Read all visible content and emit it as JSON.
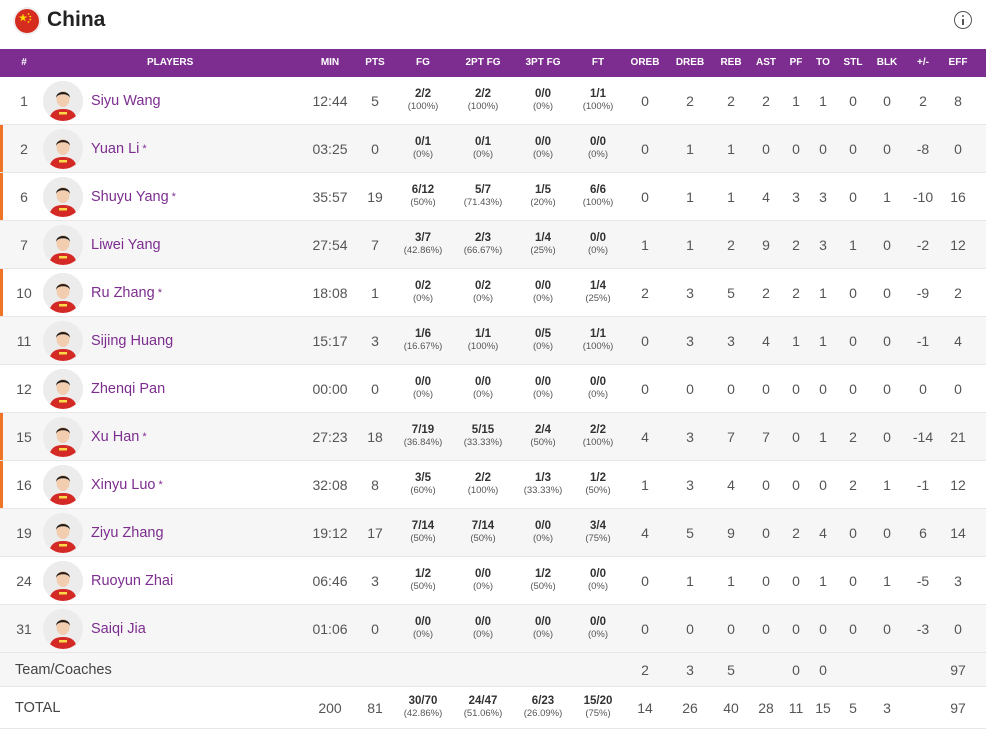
{
  "team": {
    "name": "China",
    "flag_icon": "china-flag-icon",
    "info_icon": "info-icon"
  },
  "colors": {
    "header_bg": "#7d2d8f",
    "player_name": "#7d2d8f",
    "starter_marker": "#f07426"
  },
  "columns": [
    "#",
    "PLAYERS",
    "MIN",
    "PTS",
    "FG",
    "2PT FG",
    "3PT FG",
    "FT",
    "OREB",
    "DREB",
    "REB",
    "AST",
    "PF",
    "TO",
    "STL",
    "BLK",
    "+/-",
    "EFF"
  ],
  "players": [
    {
      "num": "1",
      "name": "Siyu Wang",
      "starter": "",
      "min": "12:44",
      "pts": "5",
      "fg": "2/2",
      "fg_pct": "(100%)",
      "fg2": "2/2",
      "fg2_pct": "(100%)",
      "fg3": "0/0",
      "fg3_pct": "(0%)",
      "ft": "1/1",
      "ft_pct": "(100%)",
      "oreb": "0",
      "dreb": "2",
      "reb": "2",
      "ast": "2",
      "pf": "1",
      "to": "1",
      "stl": "0",
      "blk": "0",
      "pm": "2",
      "eff": "8"
    },
    {
      "num": "2",
      "name": "Yuan Li",
      "starter": "*",
      "min": "03:25",
      "pts": "0",
      "fg": "0/1",
      "fg_pct": "(0%)",
      "fg2": "0/1",
      "fg2_pct": "(0%)",
      "fg3": "0/0",
      "fg3_pct": "(0%)",
      "ft": "0/0",
      "ft_pct": "(0%)",
      "oreb": "0",
      "dreb": "1",
      "reb": "1",
      "ast": "0",
      "pf": "0",
      "to": "0",
      "stl": "0",
      "blk": "0",
      "pm": "-8",
      "eff": "0"
    },
    {
      "num": "6",
      "name": "Shuyu Yang",
      "starter": "*",
      "min": "35:57",
      "pts": "19",
      "fg": "6/12",
      "fg_pct": "(50%)",
      "fg2": "5/7",
      "fg2_pct": "(71.43%)",
      "fg3": "1/5",
      "fg3_pct": "(20%)",
      "ft": "6/6",
      "ft_pct": "(100%)",
      "oreb": "0",
      "dreb": "1",
      "reb": "1",
      "ast": "4",
      "pf": "3",
      "to": "3",
      "stl": "0",
      "blk": "1",
      "pm": "-10",
      "eff": "16"
    },
    {
      "num": "7",
      "name": "Liwei Yang",
      "starter": "",
      "min": "27:54",
      "pts": "7",
      "fg": "3/7",
      "fg_pct": "(42.86%)",
      "fg2": "2/3",
      "fg2_pct": "(66.67%)",
      "fg3": "1/4",
      "fg3_pct": "(25%)",
      "ft": "0/0",
      "ft_pct": "(0%)",
      "oreb": "1",
      "dreb": "1",
      "reb": "2",
      "ast": "9",
      "pf": "2",
      "to": "3",
      "stl": "1",
      "blk": "0",
      "pm": "-2",
      "eff": "12"
    },
    {
      "num": "10",
      "name": "Ru Zhang",
      "starter": "*",
      "min": "18:08",
      "pts": "1",
      "fg": "0/2",
      "fg_pct": "(0%)",
      "fg2": "0/2",
      "fg2_pct": "(0%)",
      "fg3": "0/0",
      "fg3_pct": "(0%)",
      "ft": "1/4",
      "ft_pct": "(25%)",
      "oreb": "2",
      "dreb": "3",
      "reb": "5",
      "ast": "2",
      "pf": "2",
      "to": "1",
      "stl": "0",
      "blk": "0",
      "pm": "-9",
      "eff": "2"
    },
    {
      "num": "11",
      "name": "Sijing Huang",
      "starter": "",
      "min": "15:17",
      "pts": "3",
      "fg": "1/6",
      "fg_pct": "(16.67%)",
      "fg2": "1/1",
      "fg2_pct": "(100%)",
      "fg3": "0/5",
      "fg3_pct": "(0%)",
      "ft": "1/1",
      "ft_pct": "(100%)",
      "oreb": "0",
      "dreb": "3",
      "reb": "3",
      "ast": "4",
      "pf": "1",
      "to": "1",
      "stl": "0",
      "blk": "0",
      "pm": "-1",
      "eff": "4"
    },
    {
      "num": "12",
      "name": "Zhenqi Pan",
      "starter": "",
      "min": "00:00",
      "pts": "0",
      "fg": "0/0",
      "fg_pct": "(0%)",
      "fg2": "0/0",
      "fg2_pct": "(0%)",
      "fg3": "0/0",
      "fg3_pct": "(0%)",
      "ft": "0/0",
      "ft_pct": "(0%)",
      "oreb": "0",
      "dreb": "0",
      "reb": "0",
      "ast": "0",
      "pf": "0",
      "to": "0",
      "stl": "0",
      "blk": "0",
      "pm": "0",
      "eff": "0"
    },
    {
      "num": "15",
      "name": "Xu Han",
      "starter": "*",
      "min": "27:23",
      "pts": "18",
      "fg": "7/19",
      "fg_pct": "(36.84%)",
      "fg2": "5/15",
      "fg2_pct": "(33.33%)",
      "fg3": "2/4",
      "fg3_pct": "(50%)",
      "ft": "2/2",
      "ft_pct": "(100%)",
      "oreb": "4",
      "dreb": "3",
      "reb": "7",
      "ast": "7",
      "pf": "0",
      "to": "1",
      "stl": "2",
      "blk": "0",
      "pm": "-14",
      "eff": "21"
    },
    {
      "num": "16",
      "name": "Xinyu Luo",
      "starter": "*",
      "min": "32:08",
      "pts": "8",
      "fg": "3/5",
      "fg_pct": "(60%)",
      "fg2": "2/2",
      "fg2_pct": "(100%)",
      "fg3": "1/3",
      "fg3_pct": "(33.33%)",
      "ft": "1/2",
      "ft_pct": "(50%)",
      "oreb": "1",
      "dreb": "3",
      "reb": "4",
      "ast": "0",
      "pf": "0",
      "to": "0",
      "stl": "2",
      "blk": "1",
      "pm": "-1",
      "eff": "12"
    },
    {
      "num": "19",
      "name": "Ziyu Zhang",
      "starter": "",
      "min": "19:12",
      "pts": "17",
      "fg": "7/14",
      "fg_pct": "(50%)",
      "fg2": "7/14",
      "fg2_pct": "(50%)",
      "fg3": "0/0",
      "fg3_pct": "(0%)",
      "ft": "3/4",
      "ft_pct": "(75%)",
      "oreb": "4",
      "dreb": "5",
      "reb": "9",
      "ast": "0",
      "pf": "2",
      "to": "4",
      "stl": "0",
      "blk": "0",
      "pm": "6",
      "eff": "14"
    },
    {
      "num": "24",
      "name": "Ruoyun Zhai",
      "starter": "",
      "min": "06:46",
      "pts": "3",
      "fg": "1/2",
      "fg_pct": "(50%)",
      "fg2": "0/0",
      "fg2_pct": "(0%)",
      "fg3": "1/2",
      "fg3_pct": "(50%)",
      "ft": "0/0",
      "ft_pct": "(0%)",
      "oreb": "0",
      "dreb": "1",
      "reb": "1",
      "ast": "0",
      "pf": "0",
      "to": "1",
      "stl": "0",
      "blk": "1",
      "pm": "-5",
      "eff": "3"
    },
    {
      "num": "31",
      "name": "Saiqi Jia",
      "starter": "",
      "min": "01:06",
      "pts": "0",
      "fg": "0/0",
      "fg_pct": "(0%)",
      "fg2": "0/0",
      "fg2_pct": "(0%)",
      "fg3": "0/0",
      "fg3_pct": "(0%)",
      "ft": "0/0",
      "ft_pct": "(0%)",
      "oreb": "0",
      "dreb": "0",
      "reb": "0",
      "ast": "0",
      "pf": "0",
      "to": "0",
      "stl": "0",
      "blk": "0",
      "pm": "-3",
      "eff": "0"
    }
  ],
  "team_coaches": {
    "label": "Team/Coaches",
    "oreb": "2",
    "dreb": "3",
    "reb": "5",
    "pf": "0",
    "to": "0",
    "eff": "97"
  },
  "total": {
    "label": "TOTAL",
    "min": "200",
    "pts": "81",
    "fg": "30/70",
    "fg_pct": "(42.86%)",
    "fg2": "24/47",
    "fg2_pct": "(51.06%)",
    "fg3": "6/23",
    "fg3_pct": "(26.09%)",
    "ft": "15/20",
    "ft_pct": "(75%)",
    "oreb": "14",
    "dreb": "26",
    "reb": "40",
    "ast": "28",
    "pf": "11",
    "to": "15",
    "stl": "5",
    "blk": "3",
    "pm": "",
    "eff": "97"
  }
}
